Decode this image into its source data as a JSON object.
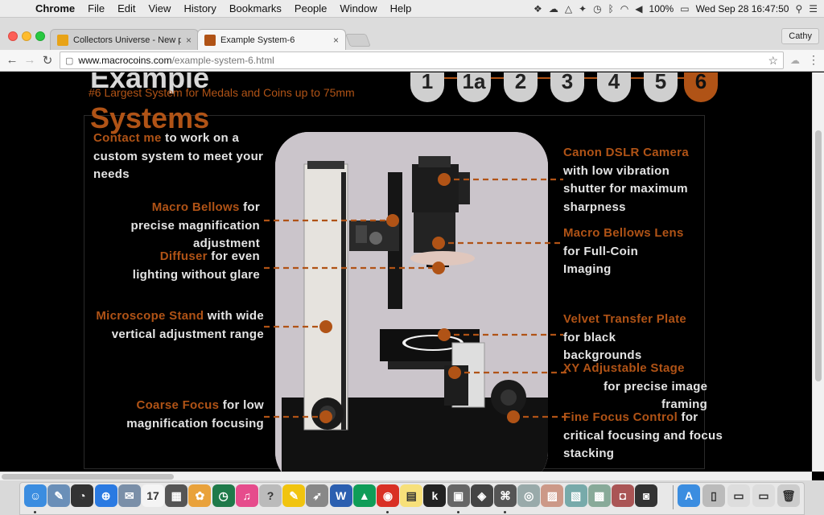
{
  "menubar": {
    "apple": "",
    "items": [
      "Chrome",
      "File",
      "Edit",
      "View",
      "History",
      "Bookmarks",
      "People",
      "Window",
      "Help"
    ],
    "battery": "100%",
    "clock": "Wed Sep 28  16:47:50"
  },
  "tabs": [
    {
      "title": "Collectors Universe - New pho",
      "close": "×",
      "favicon_color": "#e8a317"
    },
    {
      "title": "Example System-6",
      "close": "×",
      "favicon_color": "#b05316"
    }
  ],
  "profile": "Cathy",
  "address": {
    "domain": "www.macrocoins.com",
    "path": "/example-system-6.html"
  },
  "page": {
    "heading_top": "Example",
    "subtitle": "#6  Largest System for Medals and Coins up to 75mm",
    "heading_main": "Systems",
    "nav_pills": [
      "1",
      "1a",
      "2",
      "3",
      "4",
      "5",
      "6"
    ],
    "active_pill": "6",
    "accent": "#b05316",
    "labels": {
      "contact_link": "Contact me",
      "contact_rest_1": " to work on a",
      "contact_rest_2": "custom system to meet your",
      "contact_rest_3": "needs",
      "bellows_title": "Macro Bellows",
      "bellows_rest_1": "  for",
      "bellows_rest_2": "precise magnification",
      "bellows_rest_3": "adjustment",
      "diffuser_title": "Diffuser",
      "diffuser_rest_1": "  for even",
      "diffuser_rest_2": "lighting without glare",
      "stand_title": "Microscope Stand",
      "stand_rest_1": " with wide",
      "stand_rest_2": "vertical adjustment range",
      "coarse_title": "Coarse Focus",
      "coarse_rest_1": " for low",
      "coarse_rest_2": "magnification focusing",
      "camera_title": "Canon DSLR Camera",
      "camera_rest_1": "with low vibration",
      "camera_rest_2": "shutter for maximum",
      "camera_rest_3": "sharpness",
      "lens_title": "Macro Bellows Lens",
      "lens_rest_1": "for Full-Coin",
      "lens_rest_2": "Imaging",
      "velvet_title": "Velvet Transfer Plate",
      "velvet_rest_1": "for black",
      "velvet_rest_2": "backgrounds",
      "xy_title": "XY Adjustable Stage",
      "xy_rest_1": "for precise image",
      "xy_rest_2": "framing",
      "fine_title": "Fine Focus Control",
      "fine_rest_1": " for",
      "fine_rest_2": "critical focusing and focus",
      "fine_rest_3": "stacking"
    }
  },
  "dock": {
    "apps": [
      {
        "name": "Finder",
        "glyph": "☺",
        "color": "#3b8de0",
        "running": true
      },
      {
        "name": "Preview",
        "glyph": "✎",
        "color": "#6a8fb8",
        "running": false
      },
      {
        "name": "Dashboard",
        "glyph": "◔",
        "color": "#333",
        "running": false
      },
      {
        "name": "Safari",
        "glyph": "⊕",
        "color": "#2a7ae2",
        "running": false
      },
      {
        "name": "Mail",
        "glyph": "✉",
        "color": "#7a8fa8",
        "running": false
      },
      {
        "name": "Calendar",
        "glyph": "17",
        "color": "#f4f4f4",
        "running": false
      },
      {
        "name": "Calculator",
        "glyph": "▦",
        "color": "#555",
        "running": false
      },
      {
        "name": "Photos",
        "glyph": "✿",
        "color": "#e9a23b",
        "running": false
      },
      {
        "name": "Time Machine",
        "glyph": "◷",
        "color": "#1f7a4a",
        "running": false
      },
      {
        "name": "iTunes",
        "glyph": "♫",
        "color": "#e64c8c",
        "running": false
      },
      {
        "name": "Help",
        "glyph": "?",
        "color": "#bbb",
        "running": false
      },
      {
        "name": "Notes",
        "glyph": "✎",
        "color": "#f1c40f",
        "running": false
      },
      {
        "name": "Launchpad",
        "glyph": "➶",
        "color": "#888",
        "running": false
      },
      {
        "name": "Word",
        "glyph": "W",
        "color": "#2b5fb0",
        "running": false
      },
      {
        "name": "Drive",
        "glyph": "▲",
        "color": "#0f9d58",
        "running": false
      },
      {
        "name": "Chrome",
        "glyph": "◉",
        "color": "#d93025",
        "running": true
      },
      {
        "name": "Stickies",
        "glyph": "▤",
        "color": "#f7e07a",
        "running": false
      },
      {
        "name": "Kindle",
        "glyph": "k",
        "color": "#222",
        "running": false
      },
      {
        "name": "Image Capture",
        "glyph": "▣",
        "color": "#666",
        "running": true
      },
      {
        "name": "Aperture",
        "glyph": "◈",
        "color": "#444",
        "running": false
      },
      {
        "name": "Screenshot",
        "glyph": "⌘",
        "color": "#555",
        "running": true
      },
      {
        "name": "Camera",
        "glyph": "◎",
        "color": "#9aa",
        "running": false
      },
      {
        "name": "Photo Album",
        "glyph": "▨",
        "color": "#c98",
        "running": false
      },
      {
        "name": "iPhoto",
        "glyph": "▧",
        "color": "#7aa",
        "running": false
      },
      {
        "name": "Image Tool",
        "glyph": "▩",
        "color": "#8a9",
        "running": false
      },
      {
        "name": "Photo Booth",
        "glyph": "◘",
        "color": "#a55",
        "running": false
      },
      {
        "name": "Capture One",
        "glyph": "◙",
        "color": "#333",
        "running": false
      }
    ],
    "right": [
      {
        "name": "App Store",
        "glyph": "A",
        "color": "#3b8de0"
      },
      {
        "name": "Downloads",
        "glyph": "▯",
        "color": "#bbb"
      },
      {
        "name": "Screenshots",
        "glyph": "▭",
        "color": "#ddd"
      },
      {
        "name": "Documents",
        "glyph": "▭",
        "color": "#ddd"
      },
      {
        "name": "Trash",
        "glyph": "🗑",
        "color": "#ccc"
      }
    ]
  }
}
